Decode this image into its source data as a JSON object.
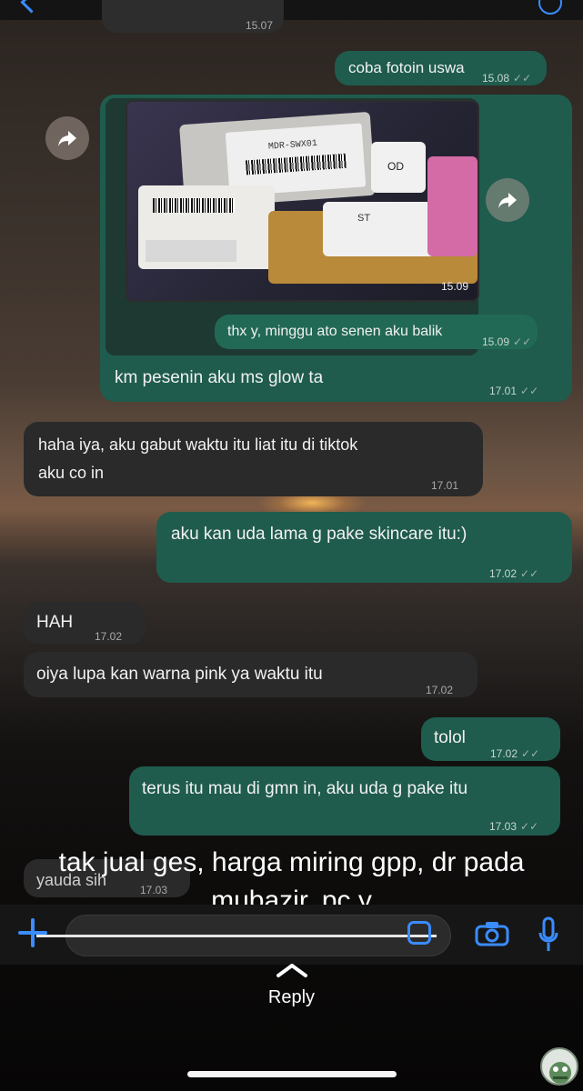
{
  "colors": {
    "incoming_bubble": "#2a2a2a",
    "outgoing_bubble": "#1f5c4d",
    "accent": "#3a8cff",
    "caption_text": "#ffffff"
  },
  "chat": {
    "top_fragment": {
      "text": "...",
      "time": "15.07"
    },
    "messages": [
      {
        "id": "m1",
        "dir": "out",
        "text": "coba fotoin uswa",
        "time": "15.08"
      },
      {
        "id": "m2",
        "dir": "photo",
        "time": "15.09",
        "labels": [
          "MDR-SWX01",
          "OD",
          "ST"
        ]
      },
      {
        "id": "m3",
        "dir": "out",
        "text": "thx y, minggu ato senen aku balik",
        "time": "15.09"
      },
      {
        "id": "m4",
        "dir": "out",
        "text": "km pesenin aku ms glow ta",
        "time": "17.01"
      },
      {
        "id": "m5",
        "dir": "in",
        "text_line1": "haha iya, aku gabut waktu itu liat itu di tiktok",
        "text_line2": "aku co in",
        "time": "17.01"
      },
      {
        "id": "m6",
        "dir": "out",
        "text": "aku kan uda lama g pake skincare itu:)",
        "time": "17.02"
      },
      {
        "id": "m7",
        "dir": "in",
        "text": "HAH",
        "time": "17.02"
      },
      {
        "id": "m8",
        "dir": "in",
        "text": "oiya lupa kan warna pink ya waktu itu",
        "time": "17.02"
      },
      {
        "id": "m9",
        "dir": "out",
        "text": "tolol",
        "time": "17.02"
      },
      {
        "id": "m10",
        "dir": "out",
        "text": "terus itu mau di gmn in, aku uda g pake itu",
        "time": "17.03"
      },
      {
        "id": "m11",
        "dir": "in",
        "text": "yauda sih",
        "time": "17.03"
      }
    ]
  },
  "caption": {
    "line1": "tak jual ges, harga miring gpp, dr pada",
    "line2": "mubazir, pc y"
  },
  "input_bar": {
    "icons": [
      "plus-icon",
      "sticker-icon",
      "camera-icon",
      "microphone-icon"
    ]
  },
  "reply": {
    "label": "Reply"
  },
  "icons": {
    "forward": "forward-arrow-icon",
    "read_receipt": "double-check-icon"
  }
}
